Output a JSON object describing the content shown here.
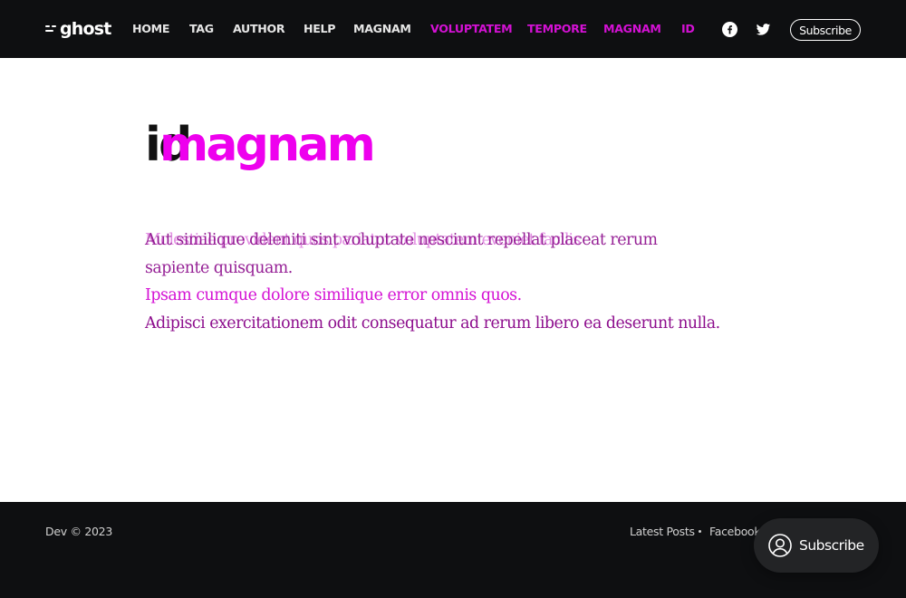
{
  "header": {
    "logo_text": "ghost",
    "nav": [
      {
        "label": "Home",
        "accent": false
      },
      {
        "label": "Tag",
        "accent": false
      },
      {
        "label": "Author",
        "accent": false
      },
      {
        "label": "Help",
        "accent": false
      },
      {
        "label": "magnam",
        "accent": false
      },
      {
        "label": "voluptatem",
        "accent": true
      },
      {
        "label": "tempore",
        "accent": true
      },
      {
        "label": "magnam",
        "accent": true
      },
      {
        "label": "id",
        "accent": true
      }
    ],
    "social_icons": [
      "facebook-icon",
      "twitter-icon"
    ],
    "subscribe_label": "Subscribe"
  },
  "main": {
    "title_layer_1": "id",
    "title_layer_2": "magnam",
    "paragraph_overlap_1": "Molestiae provident quos pariatur voluptatem eveniet facilis",
    "paragraph_overlap_2": "Aut similique deleniti sint voluptate nesciunt repellat placeat rerum",
    "paragraph_overlap_2b": "sapiente quisquam.",
    "excerpt": "Ipsam cumque dolore similique error omnis quos.",
    "last_paragraph": "Adipisci exercitationem odit consequatur ad rerum libero ea deserunt nulla."
  },
  "footer": {
    "copyright": "Dev © 2023",
    "links": [
      "Latest Posts",
      "Facebook"
    ]
  },
  "portal": {
    "label": "Subscribe",
    "icon": "user-circle-icon"
  },
  "colors": {
    "header_bg": "#0e0f11",
    "accent": "#d411d4",
    "title_accent": "#ee00ee",
    "text_purple": "#8d0e8d"
  }
}
